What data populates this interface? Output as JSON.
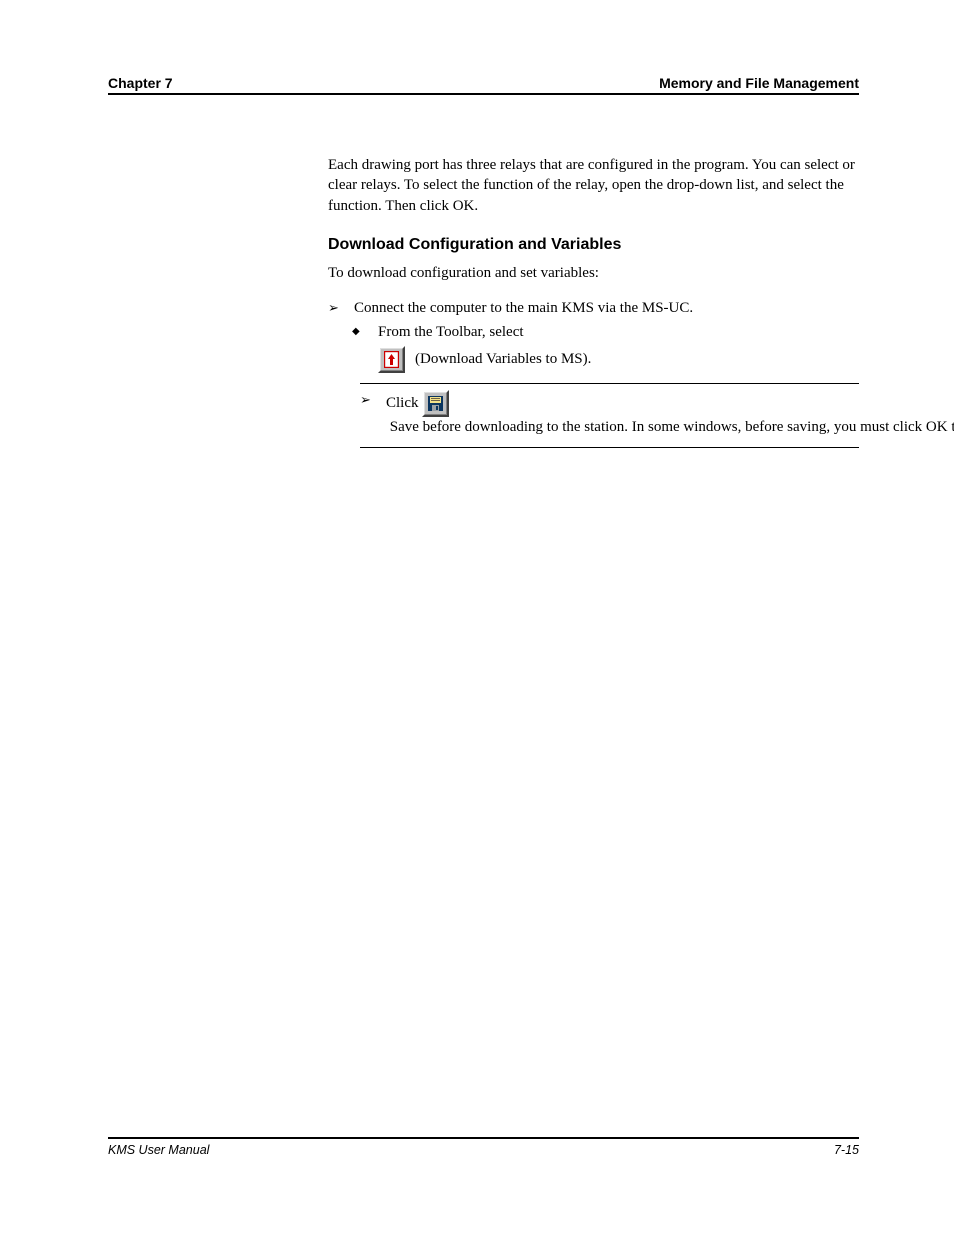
{
  "header": {
    "chapter": "Chapter 7",
    "title": "Memory and File Management"
  },
  "body": {
    "p1": "Each drawing port has three relays that are configured in the program. You can select or clear relays. To select the function of the relay, open the drop-down list, and select the function. Then click OK.",
    "h2": "Download Configuration and Variables",
    "intro": "To download configuration and set variables:",
    "s1": "Connect the computer to the main KMS via the MS-UC.",
    "s2": "From the Toolbar, select",
    "btn_download_label": "(Download Variables to MS).",
    "note_pre": "Click ",
    "note_post": " Save before downloading to the station. In some windows, before saving, you must click OK to close the window."
  },
  "footer": {
    "left": "KMS User Manual",
    "right": "7-15"
  }
}
